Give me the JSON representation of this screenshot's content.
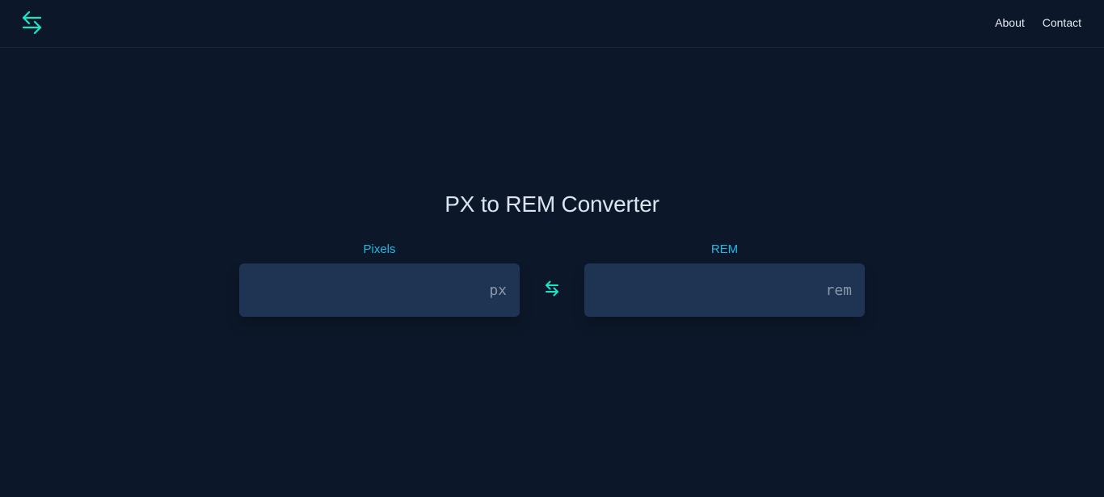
{
  "header": {
    "logo_icon": "swap-arrows-icon",
    "nav": [
      {
        "label": "About"
      },
      {
        "label": "Contact"
      }
    ]
  },
  "main": {
    "title": "PX to REM Converter",
    "pixels": {
      "label": "Pixels",
      "value": "",
      "placeholder": "px"
    },
    "rem": {
      "label": "REM",
      "value": "",
      "placeholder": "rem"
    },
    "swap_icon": "swap-arrows-icon"
  },
  "colors": {
    "background": "#0c1729",
    "accent": "#19e6c8",
    "label": "#22b8e6",
    "input_bg": "#1f3453",
    "text": "#e2e8f0"
  }
}
